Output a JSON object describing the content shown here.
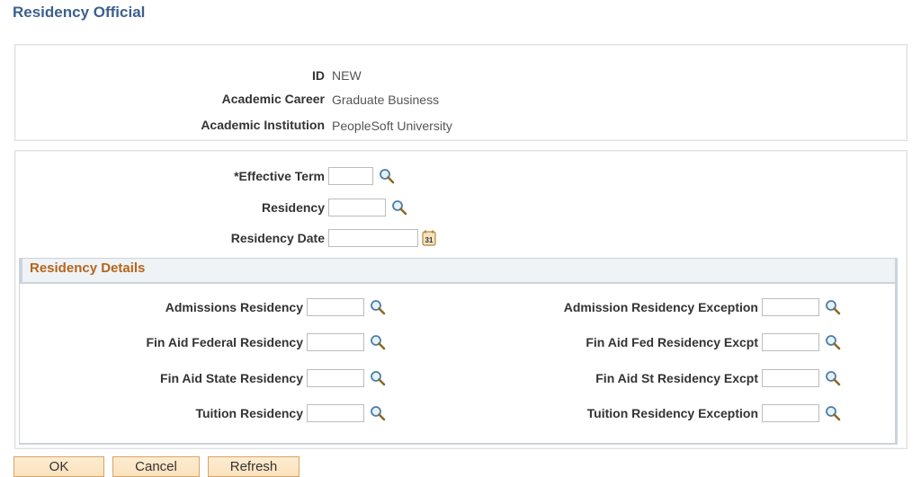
{
  "page": {
    "title": "Residency Official"
  },
  "header": {
    "fields": [
      {
        "label": "ID",
        "value": "NEW"
      },
      {
        "label": "Academic Career",
        "value": "Graduate Business"
      },
      {
        "label": "Academic Institution",
        "value": "PeopleSoft University"
      }
    ]
  },
  "form": {
    "effective_term": {
      "label": "*Effective Term",
      "value": "",
      "icon": "lookup-icon"
    },
    "residency": {
      "label": "Residency",
      "value": "",
      "icon": "lookup-icon"
    },
    "residency_date": {
      "label": "Residency Date",
      "value": "",
      "icon": "calendar-icon"
    }
  },
  "details": {
    "title": "Residency Details",
    "left": [
      {
        "label": "Admissions Residency",
        "value": ""
      },
      {
        "label": "Fin Aid Federal Residency",
        "value": ""
      },
      {
        "label": "Fin Aid State Residency",
        "value": ""
      },
      {
        "label": "Tuition Residency",
        "value": ""
      }
    ],
    "right": [
      {
        "label": "Admission Residency Exception",
        "value": ""
      },
      {
        "label": "Fin Aid Fed Residency Excpt",
        "value": ""
      },
      {
        "label": "Fin Aid St Residency Excpt",
        "value": ""
      },
      {
        "label": "Tuition Residency Exception",
        "value": ""
      }
    ]
  },
  "buttons": {
    "ok": "OK",
    "cancel": "Cancel",
    "refresh": "Refresh"
  },
  "colors": {
    "title": "#3d5f8e",
    "section_title": "#b5651d",
    "button_bg": "#fbe2bd"
  }
}
